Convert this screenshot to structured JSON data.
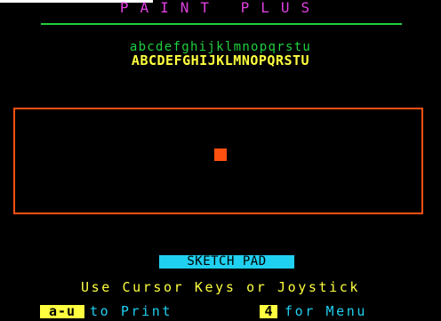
{
  "header": {
    "title": "PAINT  PLUS"
  },
  "alphabet": {
    "lowercase": "abcdefghijklmnopqrstu",
    "uppercase": "ABCDEFGHIJKLMNOPQRSTU"
  },
  "mode_badge": "SKETCH PAD",
  "instructions": "Use Cursor Keys or Joystick",
  "hints": {
    "print_key": "a-u",
    "print_label": "to Print",
    "menu_key": "4",
    "menu_label": "for Menu"
  },
  "colors": {
    "background": "#000000",
    "title": "#e040e0",
    "rule": "#20d040",
    "lowercase": "#20d040",
    "uppercase": "#ffff40",
    "canvas_border": "#ff5010",
    "cursor": "#ff5010",
    "badge": "#20d0f0",
    "hint_text": "#20d0f0",
    "key_highlight": "#ffff40"
  }
}
